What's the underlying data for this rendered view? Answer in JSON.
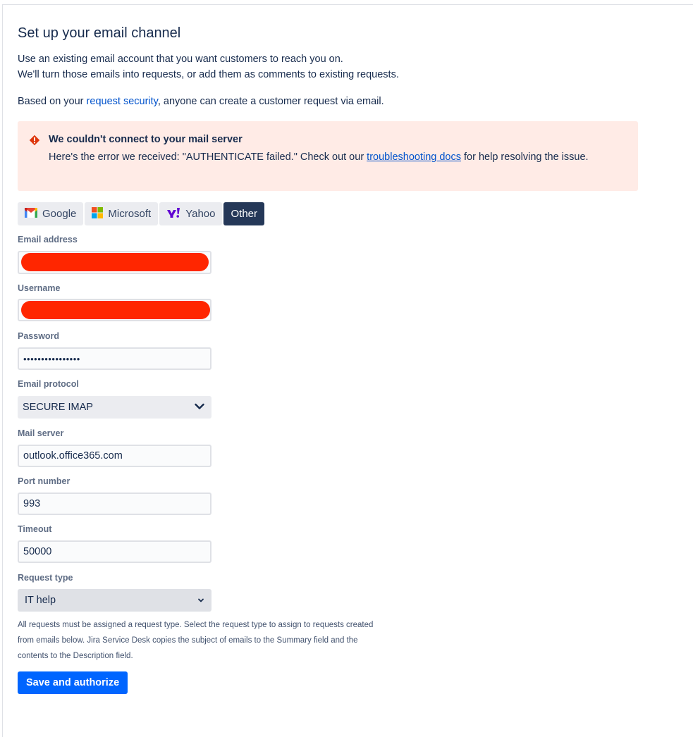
{
  "page": {
    "title": "Set up your email channel",
    "intro_line1": "Use an existing email account that you want customers to reach you on.",
    "intro_line2": "We'll turn those emails into requests, or add them as comments to existing requests.",
    "security_prefix": "Based on your ",
    "security_link": "request security",
    "security_suffix": ", anyone can create a customer request via email."
  },
  "error": {
    "title": "We couldn't connect to your mail server",
    "body_prefix": "Here's the error we received: \"AUTHENTICATE failed.\" Check out our ",
    "link": "troubleshooting docs",
    "body_suffix": " for help resolving the issue.",
    "icon": "error-icon",
    "color": "#de350b"
  },
  "tabs": [
    {
      "label": "Google",
      "icon": "google-icon",
      "active": false
    },
    {
      "label": "Microsoft",
      "icon": "microsoft-icon",
      "active": false
    },
    {
      "label": "Yahoo",
      "icon": "yahoo-icon",
      "active": false
    },
    {
      "label": "Other",
      "icon": "",
      "active": true
    }
  ],
  "form": {
    "email_label": "Email address",
    "username_label": "Username",
    "password_label": "Password",
    "password_value": "••••••••••••••••",
    "protocol_label": "Email protocol",
    "protocol_value": "SECURE IMAP",
    "server_label": "Mail server",
    "server_value": "outlook.office365.com",
    "port_label": "Port number",
    "port_value": "993",
    "timeout_label": "Timeout",
    "timeout_value": "50000",
    "request_type_label": "Request type",
    "request_type_value": "IT help",
    "help_text": "All requests must be assigned a request type. Select the request type to assign to requests created from emails below. Jira Service Desk copies the subject of emails to the Summary field and the contents to the Description field.",
    "submit_label": "Save and authorize"
  },
  "colors": {
    "accent": "#0065ff",
    "link": "#0052cc",
    "error_bg": "#ffebe6",
    "active_tab": "#253858",
    "redaction": "#ff2600"
  }
}
